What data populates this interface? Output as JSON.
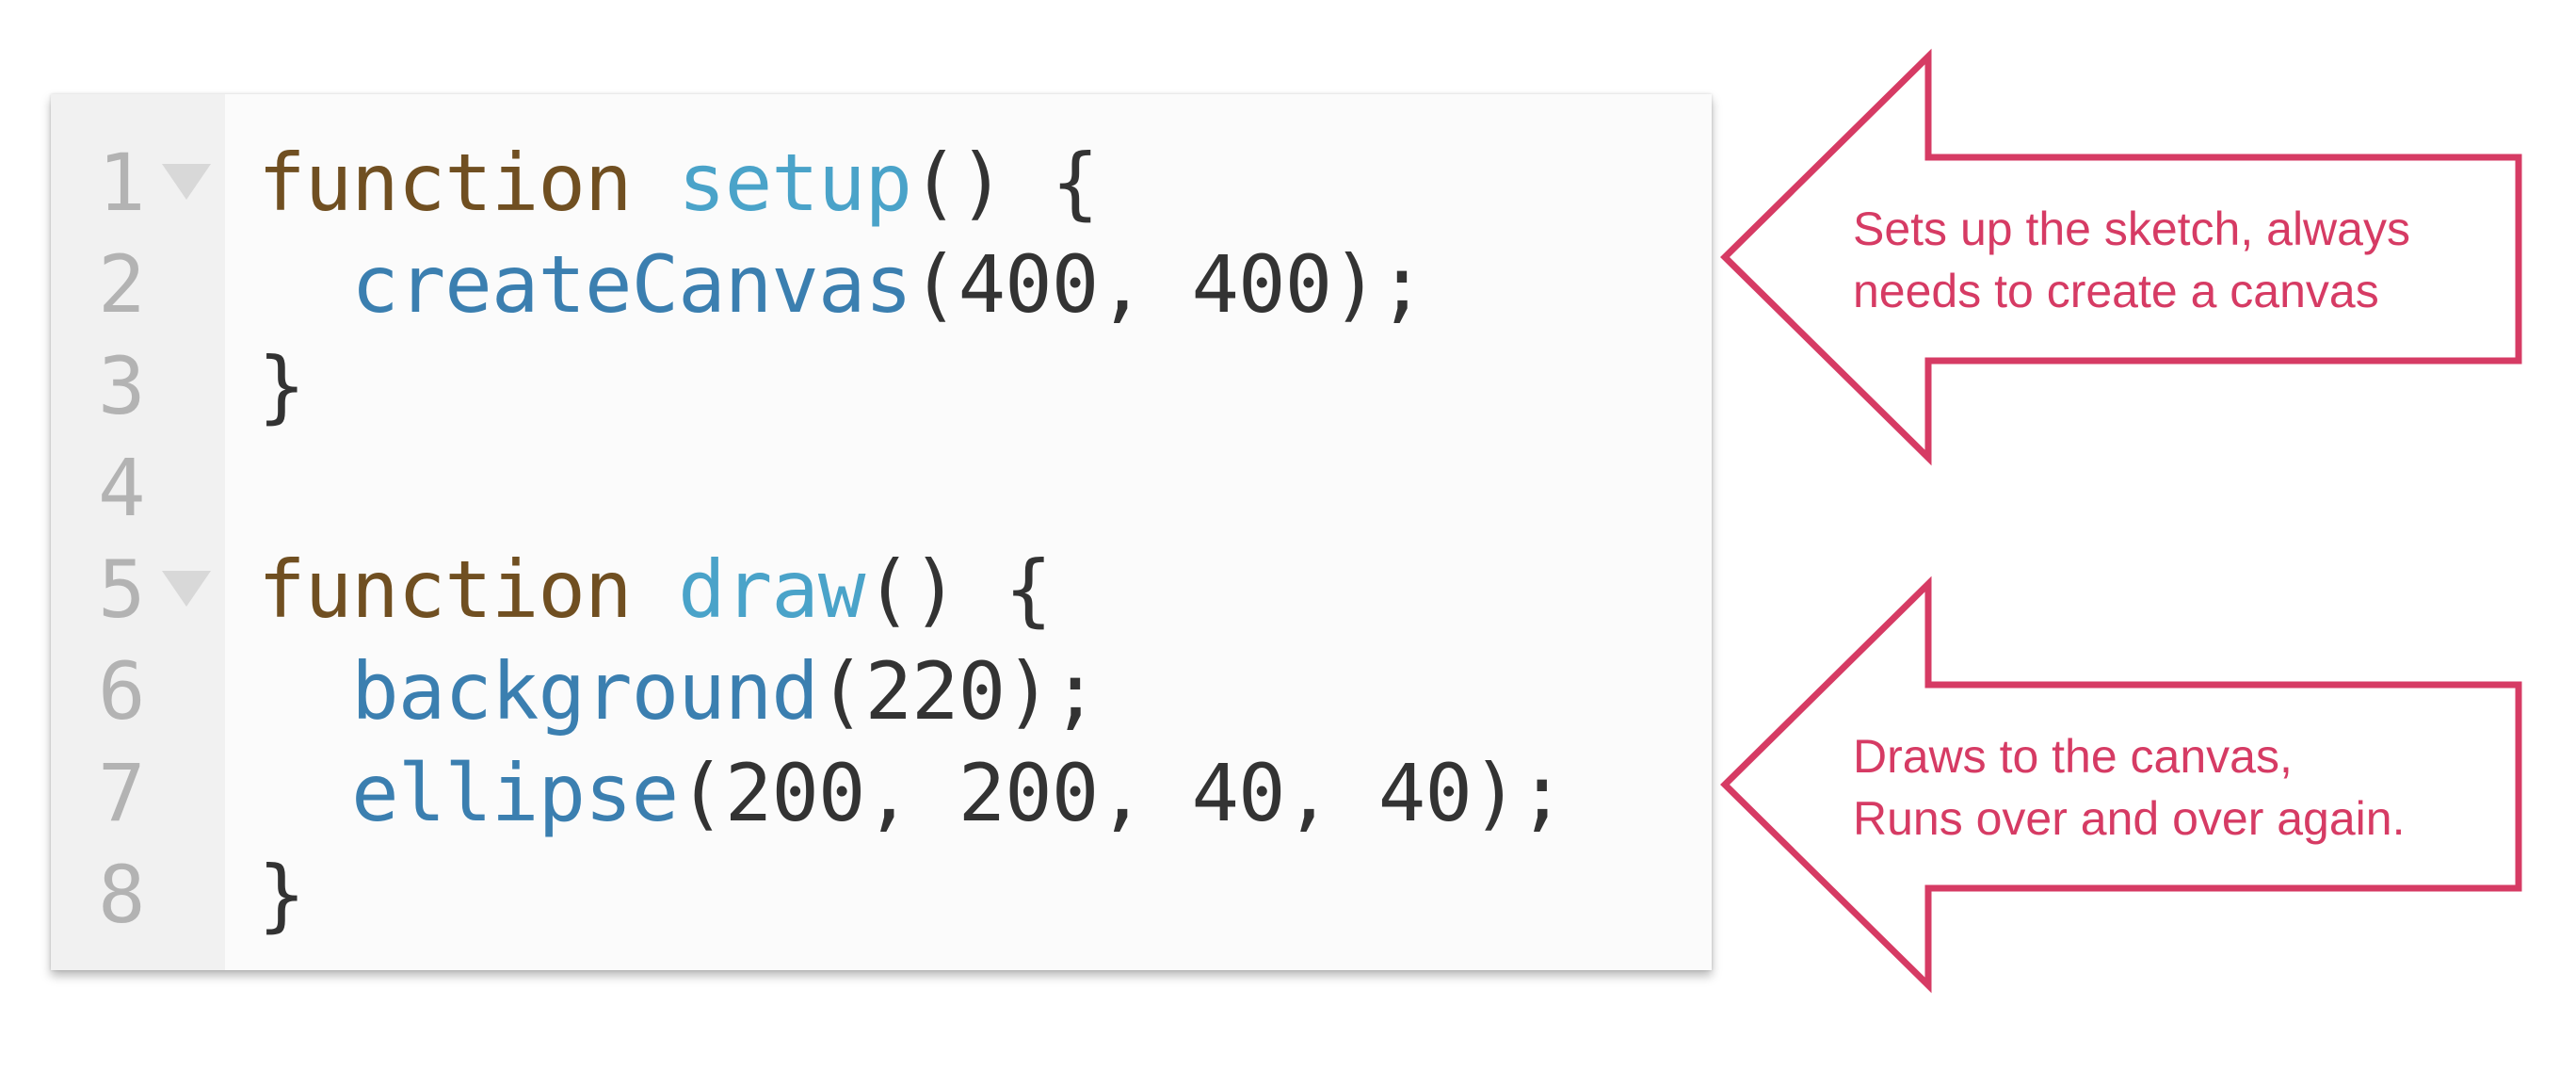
{
  "editor": {
    "lines": [
      {
        "number": "1",
        "foldable": true,
        "tokens": [
          {
            "text": "function",
            "kind": "kw"
          },
          {
            "text": " ",
            "kind": "punc"
          },
          {
            "text": "setup",
            "kind": "fn-def"
          },
          {
            "text": "() {",
            "kind": "punc"
          }
        ]
      },
      {
        "number": "2",
        "foldable": false,
        "tokens": [
          {
            "text": "  ",
            "kind": "punc"
          },
          {
            "text": "createCanvas",
            "kind": "fn-call"
          },
          {
            "text": "(400, 400);",
            "kind": "punc"
          }
        ]
      },
      {
        "number": "3",
        "foldable": false,
        "tokens": [
          {
            "text": "}",
            "kind": "punc"
          }
        ]
      },
      {
        "number": "4",
        "foldable": false,
        "tokens": []
      },
      {
        "number": "5",
        "foldable": true,
        "tokens": [
          {
            "text": "function",
            "kind": "kw"
          },
          {
            "text": " ",
            "kind": "punc"
          },
          {
            "text": "draw",
            "kind": "fn-def"
          },
          {
            "text": "() {",
            "kind": "punc"
          }
        ]
      },
      {
        "number": "6",
        "foldable": false,
        "tokens": [
          {
            "text": "  ",
            "kind": "punc"
          },
          {
            "text": "background",
            "kind": "fn-call"
          },
          {
            "text": "(220);",
            "kind": "punc"
          }
        ]
      },
      {
        "number": "7",
        "foldable": false,
        "tokens": [
          {
            "text": "  ",
            "kind": "punc"
          },
          {
            "text": "ellipse",
            "kind": "fn-call"
          },
          {
            "text": "(200, 200, 40, 40);",
            "kind": "punc"
          }
        ]
      },
      {
        "number": "8",
        "foldable": false,
        "tokens": [
          {
            "text": "}",
            "kind": "punc"
          }
        ]
      }
    ],
    "colors": {
      "keyword": "#704f21",
      "function_definition": "#4aa3c9",
      "function_call": "#3b7fb0",
      "text": "#333333",
      "line_number": "#b3b3b3",
      "gutter": "#f1f1f1",
      "background": "#fbfbfb"
    }
  },
  "annotations": {
    "setup": {
      "line1": "Sets up the sketch, always",
      "line2": "needs to create a canvas"
    },
    "draw": {
      "line1": "Draws to the canvas,",
      "line2": "Runs over and over again."
    },
    "arrow_color": "#d63b64"
  }
}
